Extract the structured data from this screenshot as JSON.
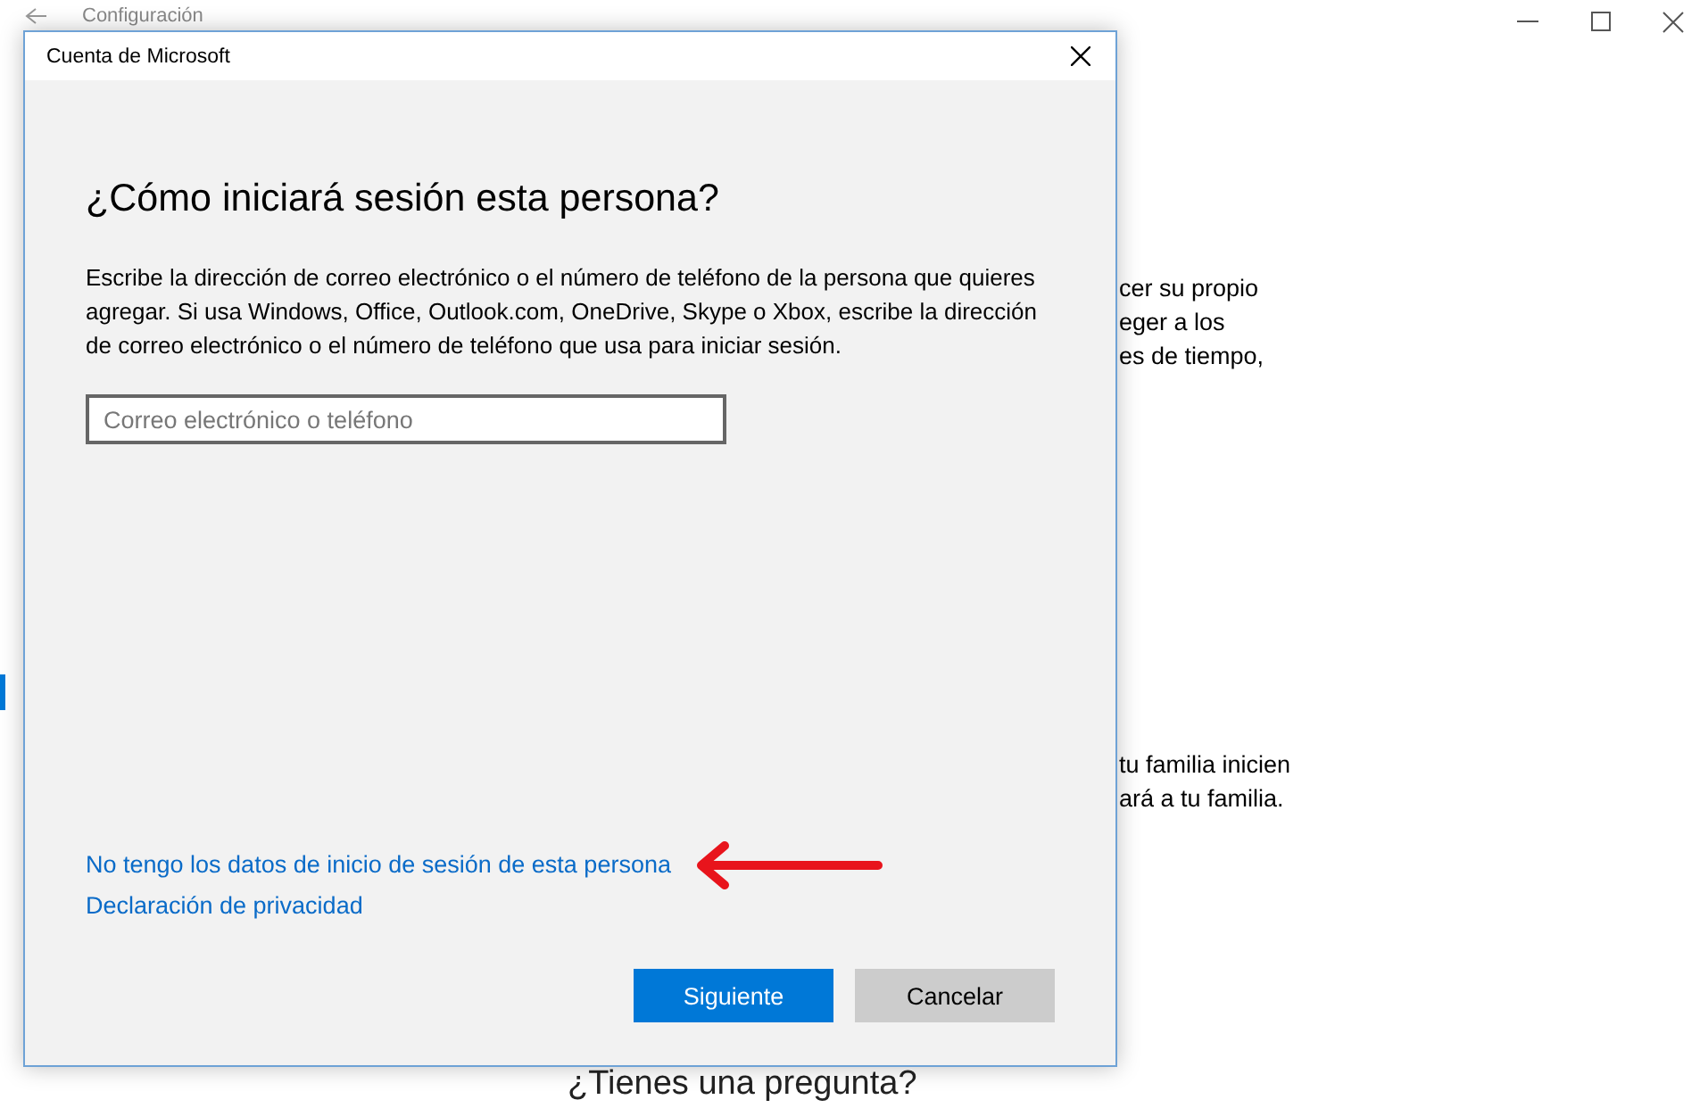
{
  "background_window": {
    "title": "Configuración",
    "text_groups": [
      [
        "cer su propio",
        "eger a los",
        "es de tiempo,"
      ],
      [
        "tu familia inicien",
        "ará a tu familia."
      ]
    ],
    "question": "¿Tienes una pregunta?"
  },
  "dialog": {
    "title": "Cuenta de Microsoft",
    "heading": "¿Cómo iniciará sesión esta persona?",
    "description": "Escribe la dirección de correo electrónico o el número de teléfono de la persona que quieres agregar. Si usa Windows, Office, Outlook.com, OneDrive, Skype o Xbox, escribe la dirección de correo electrónico o el número de teléfono que usa para iniciar sesión.",
    "email_field": {
      "placeholder": "Correo electrónico o teléfono"
    },
    "links": [
      "No tengo los datos de inicio de sesión de esta persona",
      "Declaración de privacidad"
    ],
    "buttons": [
      {
        "label": "Siguiente",
        "kind": "primary"
      },
      {
        "label": "Cancelar",
        "kind": "secondary"
      }
    ]
  }
}
